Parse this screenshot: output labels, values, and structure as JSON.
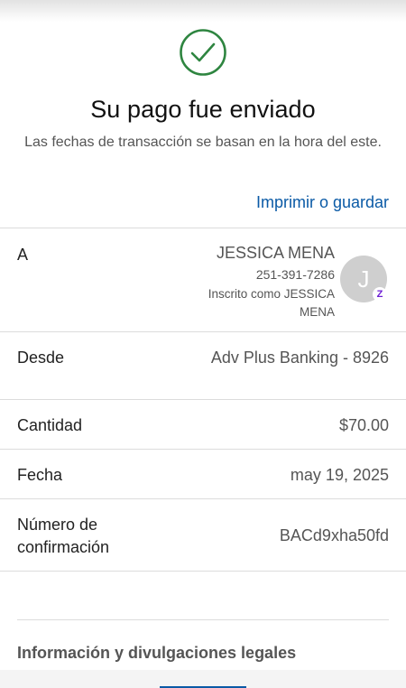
{
  "status": {
    "title": "Su pago fue enviado",
    "subtitle": "Las fechas de transacción se basan en la hora del este.",
    "icon": "check-circle-icon",
    "icon_color": "#2e8540"
  },
  "actions": {
    "print_label": "Imprimir o guardar"
  },
  "details": {
    "to": {
      "label": "A",
      "name": "JESSICA MENA",
      "phone": "251-391-7286",
      "enrolled_as": "Inscrito como JESSICA MENA",
      "avatar_initial": "J",
      "badge": "Z"
    },
    "from": {
      "label": "Desde",
      "value": "Adv Plus Banking - 8926"
    },
    "amount": {
      "label": "Cantidad",
      "value": "$70.00"
    },
    "date": {
      "label": "Fecha",
      "value": "may 19, 2025"
    },
    "confirmation": {
      "label": "Número de confirmación",
      "value": "BACd9xha50fd"
    }
  },
  "legal": {
    "title": "Información y divulgaciones legales"
  },
  "colors": {
    "link": "#0a5aa6",
    "zelle": "#6d1ed4",
    "divider": "#dcdcdc"
  }
}
